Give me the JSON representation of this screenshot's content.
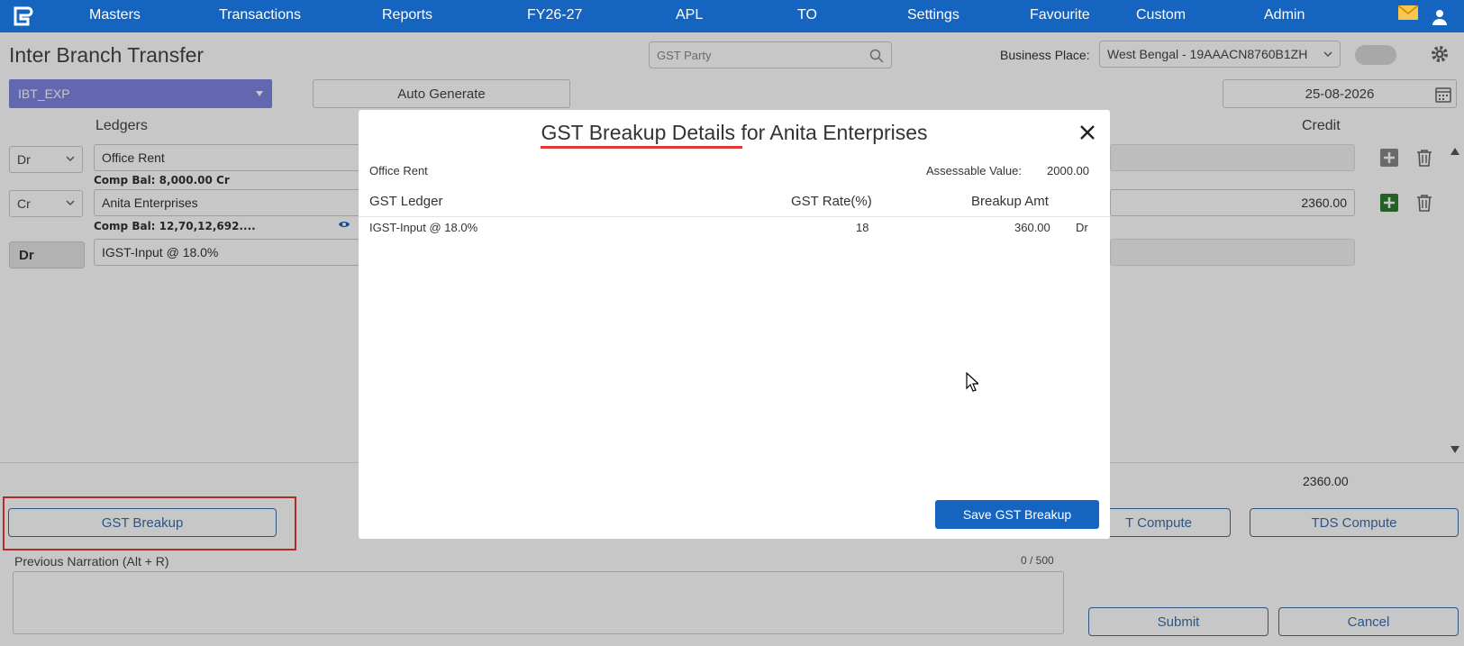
{
  "nav": {
    "items": [
      "Masters",
      "Transactions",
      "Reports",
      "FY26-27",
      "APL",
      "TO",
      "Settings",
      "Favourite",
      "Custom",
      "Admin"
    ]
  },
  "page": {
    "title": "Inter Branch Transfer",
    "gst_party_placeholder": "GST Party",
    "business_place_label": "Business Place:",
    "business_place_value": "West Bengal - 19AAACN8760B1ZH",
    "voucher_type": "IBT_EXP",
    "auto_generate": "Auto Generate",
    "date": "25-08-2026",
    "col_ledgers": "Ledgers",
    "col_credit": "Credit"
  },
  "rows": [
    {
      "drcr": "Dr",
      "ledger": "Office Rent",
      "comp_bal": "Comp Bal: 8,000.00 Cr",
      "credit": ""
    },
    {
      "drcr": "Cr",
      "ledger": "Anita Enterprises",
      "comp_bal": "Comp Bal: 12,70,12,692....",
      "credit": "2360.00"
    },
    {
      "drcr": "Dr",
      "ledger": "IGST-Input @ 18.0%",
      "comp_bal": "",
      "credit": ""
    }
  ],
  "footer": {
    "total": "2360.00",
    "gst_breakup": "GST Breakup",
    "tcs_compute": "T Compute",
    "tds_compute": "TDS Compute",
    "narration_label": "Previous Narration (Alt + R)",
    "narration_count": "0 / 500",
    "submit": "Submit",
    "cancel": "Cancel"
  },
  "modal": {
    "title": "GST Breakup Details for Anita Enterprises",
    "ledger_name": "Office Rent",
    "assessable_label": "Assessable Value:",
    "assessable_value": "2000.00",
    "headers": {
      "ledger": "GST Ledger",
      "rate": "GST Rate(%)",
      "amount": "Breakup Amt"
    },
    "rows": [
      {
        "ledger": "IGST-Input @ 18.0%",
        "rate": "18",
        "amount": "360.00",
        "drcr": "Dr"
      }
    ],
    "save": "Save GST Breakup"
  },
  "colors": {
    "nav": "#1565c0",
    "voucher_type": "#7f85e0",
    "highlight": "#e53935",
    "button_primary": "#1565c0",
    "plus_green": "#2e7d32"
  }
}
